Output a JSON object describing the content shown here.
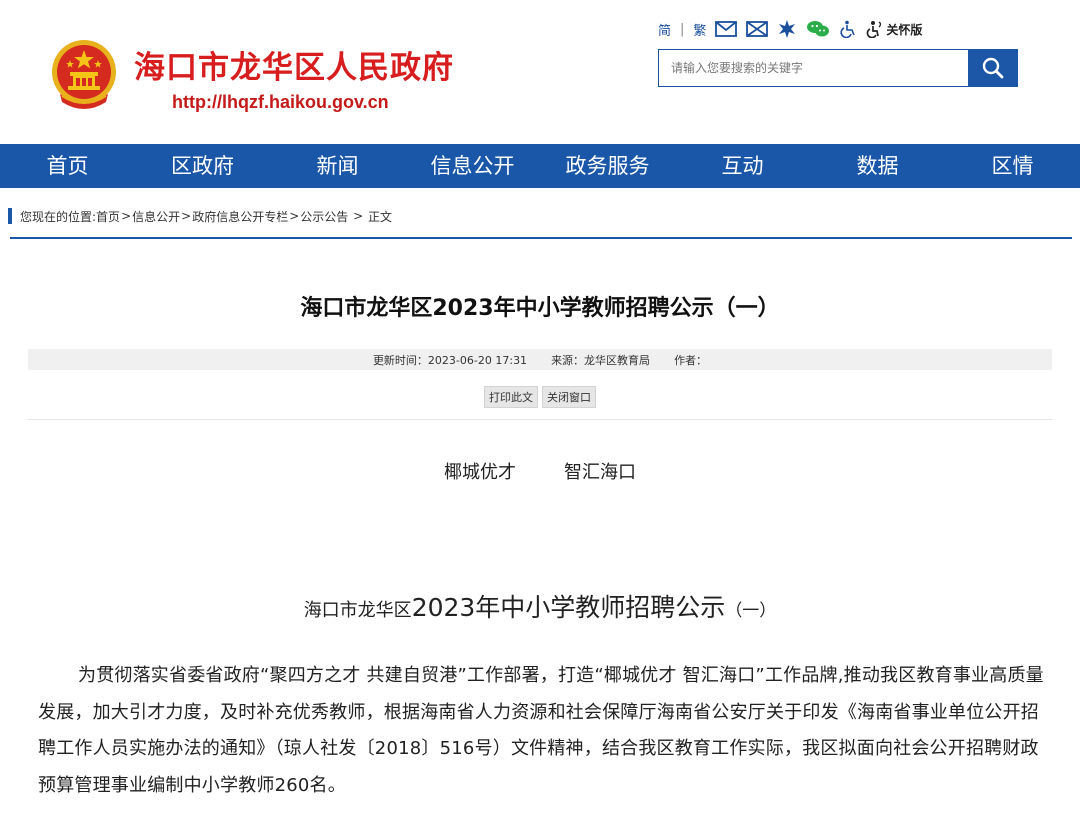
{
  "header": {
    "site_title": "海口市龙华区人民政府",
    "site_url": "http://lhqzf.haikou.gov.cn"
  },
  "toolbar": {
    "simplified": "简",
    "traditional": "繁",
    "care_mode": "关怀版",
    "icons": [
      "mail-icon",
      "envelope-x-icon",
      "weibo-star-icon",
      "wechat-icon",
      "accessibility-icon",
      "care-mode-icon"
    ]
  },
  "search": {
    "placeholder": "请输入您要搜索的关键字"
  },
  "nav": {
    "items": [
      "首页",
      "区政府",
      "新闻",
      "信息公开",
      "政务服务",
      "互动",
      "数据",
      "区情"
    ]
  },
  "breadcrumb": {
    "prefix": "您现在的位置:",
    "items": [
      "首页",
      "信息公开",
      "政府信息公开专栏",
      "公示公告",
      "正文"
    ],
    "separators": [
      ">",
      ">",
      ">",
      " > "
    ]
  },
  "article": {
    "title": "海口市龙华区2023年中小学教师招聘公示（一）",
    "update_time": "更新时间：2023-06-20 17:31",
    "source": "来源：龙华区教育局",
    "author": "作者：",
    "print_label": "打印此文",
    "close_label": "关闭窗口",
    "slogan_left": "椰城优才",
    "slogan_right": "智汇海口",
    "subtitle_prefix": "海口市龙华区",
    "subtitle_main": "2023年中小学教师招聘公示",
    "subtitle_suffix": "（一）",
    "paragraph_1": "为贯彻落实省委省政府“聚四方之才 共建自贸港”工作部署，打造“椰城优才 智汇海口”工作品牌,推动我区教育事业高质量发展，加大引才力度，及时补充优秀教师，根据海南省人力资源和社会保障厅海南省公安厅关于印发《海南省事业单位公开招聘工作人员实施办法的通知》（琼人社发〔2018〕516号）文件精神，结合我区教育工作实际，我区拟面向社会公开招聘财政预算管理事业编制中小学教师260名。"
  },
  "colors": {
    "brand_red": "#d71d1d",
    "nav_blue": "#1b57a8"
  }
}
